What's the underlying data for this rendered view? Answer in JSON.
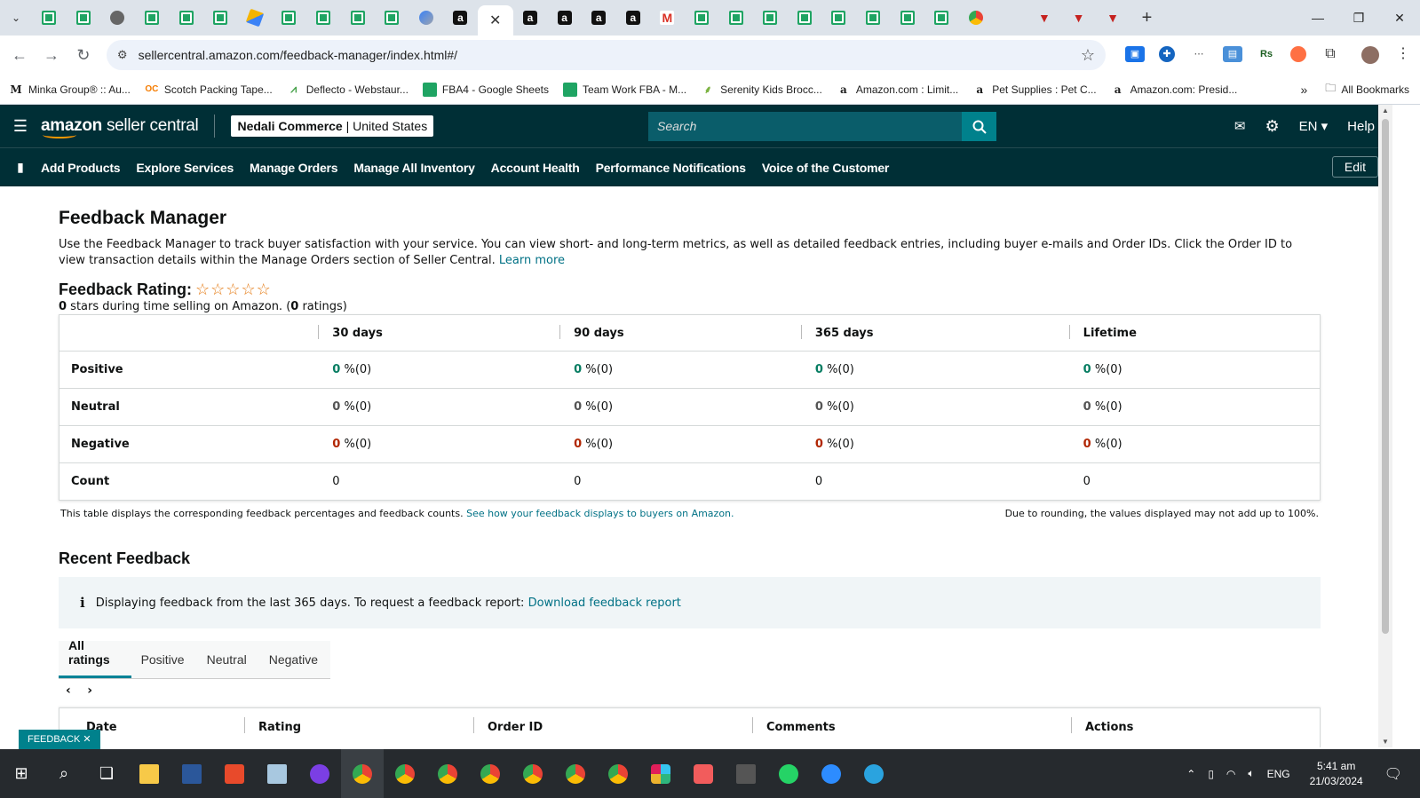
{
  "browser": {
    "tab_favicons": [
      "sheet",
      "sheet",
      "gray",
      "sheet",
      "sheet",
      "sheet",
      "orange",
      "sheet",
      "sheet",
      "sheet",
      "sheet",
      "blue",
      "amz",
      "active",
      "amz",
      "amz",
      "amz",
      "amz",
      "mail",
      "sheet",
      "sheet",
      "sheet",
      "sheet",
      "sheet",
      "sheet",
      "sheet",
      "sheet",
      "multi",
      "blank",
      "red",
      "red",
      "red"
    ],
    "new_tab": "+",
    "url": "sellercentral.amazon.com/feedback-manager/index.html#/",
    "bookmarks": [
      {
        "icon": "M",
        "label": "Minka Group® :: Au..."
      },
      {
        "icon": "OC",
        "label": "Scotch Packing Tape..."
      },
      {
        "icon": "D",
        "label": "Deflecto - Webstaur..."
      },
      {
        "icon": "sheet",
        "label": "FBA4 - Google Sheets"
      },
      {
        "icon": "sheet",
        "label": "Team Work FBA - M..."
      },
      {
        "icon": "leaf",
        "label": "Serenity Kids Brocc..."
      },
      {
        "icon": "a",
        "label": "Amazon.com : Limit..."
      },
      {
        "icon": "a",
        "label": "Pet Supplies : Pet C..."
      },
      {
        "icon": "a",
        "label": "Amazon.com: Presid..."
      }
    ],
    "all_bookmarks": "All Bookmarks"
  },
  "header": {
    "logo_brand": "amazon",
    "logo_text": "seller central",
    "store_name": "Nedali Commerce",
    "store_region": "United States",
    "search_placeholder": "Search",
    "language": "EN",
    "help": "Help"
  },
  "nav": {
    "links": [
      "Add Products",
      "Explore Services",
      "Manage Orders",
      "Manage All Inventory",
      "Account Health",
      "Performance Notifications",
      "Voice of the Customer"
    ],
    "edit": "Edit"
  },
  "page": {
    "title": "Feedback Manager",
    "description": "Use the Feedback Manager to track buyer satisfaction with your service. You can view short- and long-term metrics, as well as detailed feedback entries, including buyer e-mails and Order IDs. Click the Order ID to view transaction details within the Manage Orders section of Seller Central.",
    "learn_more": "Learn more",
    "rating_label": "Feedback Rating:",
    "rating_stars": 0,
    "stars_glyphs": "☆☆☆☆☆",
    "stars_value": "0",
    "stars_text_1": " stars during time selling on Amazon. (",
    "ratings_count": "0",
    "stars_text_2": " ratings)"
  },
  "feedback_table": {
    "columns": [
      "30 days",
      "90 days",
      "365 days",
      "Lifetime"
    ],
    "rows": [
      {
        "label": "Positive",
        "type": "pos",
        "values": [
          {
            "num": "0",
            "rest": " %(0)"
          },
          {
            "num": "0",
            "rest": " %(0)"
          },
          {
            "num": "0",
            "rest": " %(0)"
          },
          {
            "num": "0",
            "rest": " %(0)"
          }
        ]
      },
      {
        "label": "Neutral",
        "type": "neu",
        "values": [
          {
            "num": "0",
            "rest": " %(0)"
          },
          {
            "num": "0",
            "rest": " %(0)"
          },
          {
            "num": "0",
            "rest": " %(0)"
          },
          {
            "num": "0",
            "rest": " %(0)"
          }
        ]
      },
      {
        "label": "Negative",
        "type": "neg",
        "values": [
          {
            "num": "0",
            "rest": " %(0)"
          },
          {
            "num": "0",
            "rest": " %(0)"
          },
          {
            "num": "0",
            "rest": " %(0)"
          },
          {
            "num": "0",
            "rest": " %(0)"
          }
        ]
      },
      {
        "label": "Count",
        "type": "count",
        "values": [
          {
            "num": "",
            "rest": "0"
          },
          {
            "num": "",
            "rest": "0"
          },
          {
            "num": "",
            "rest": "0"
          },
          {
            "num": "",
            "rest": "0"
          }
        ]
      }
    ],
    "note_left": "This table displays the corresponding feedback percentages and feedback counts.",
    "note_link": "See how your feedback displays to buyers on Amazon.",
    "note_right": "Due to rounding, the values displayed may not add up to 100%."
  },
  "recent": {
    "title": "Recent Feedback",
    "info_text": "Displaying feedback from the last 365 days. To request a feedback report:",
    "info_link": "Download feedback report",
    "tabs": [
      "All ratings",
      "Positive",
      "Neutral",
      "Negative"
    ],
    "active_tab": 0,
    "table_headers": [
      "Date",
      "Rating",
      "Order ID",
      "Comments",
      "Actions"
    ]
  },
  "feedback_tab": "FEEDBACK ✕",
  "taskbar": {
    "language": "ENG",
    "time": "5:41 am",
    "date": "21/03/2024"
  },
  "colors": {
    "header_bg": "#002f36",
    "positive": "#067d62",
    "negative": "#b12704",
    "link": "#007185",
    "accent": "#00818c"
  }
}
